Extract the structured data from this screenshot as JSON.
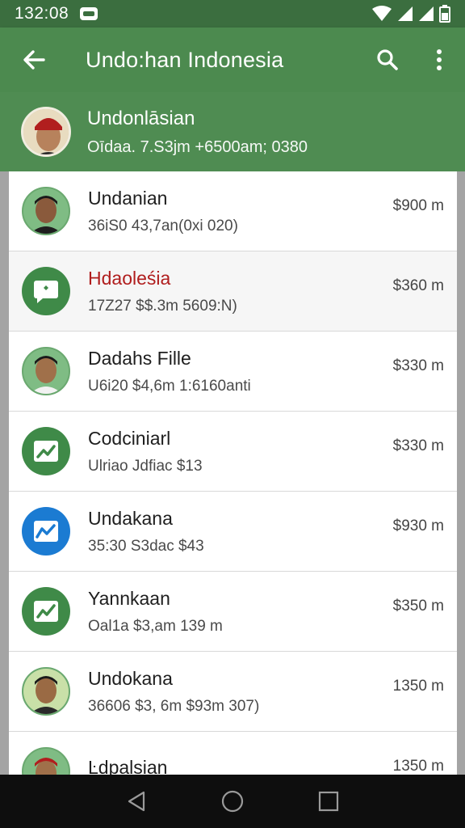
{
  "status_bar": {
    "time": "132:08",
    "icons": [
      "notification-icon",
      "wifi-icon",
      "signal-icon",
      "signal-icon",
      "battery-icon"
    ]
  },
  "app_bar": {
    "title": "Undo:han Indonesia",
    "back_icon": "arrow-back-icon",
    "search_icon": "search-icon",
    "menu_icon": "more-vert-icon"
  },
  "profile": {
    "name": "Undonlāsian",
    "meta": "Oīdaa. 7.S3jm +6500am; 0380"
  },
  "list": {
    "items": [
      {
        "title": "Undanian",
        "subtitle": "36iS0 43,7an(0xi 020)",
        "amount": "$900 m",
        "icon": "person-avatar"
      },
      {
        "title": "Hdaoleśia",
        "subtitle": "17Z27 $$.3m 5609:N)",
        "amount": "$360 m",
        "icon": "chat-bubble-icon"
      },
      {
        "title": "Dadahs Fille",
        "subtitle": "U6i20 $4,6m 1:6160anti",
        "amount": "$330 m",
        "icon": "person-avatar"
      },
      {
        "title": "Codciniarl",
        "subtitle": "Ulriao Jdfiac $13",
        "amount": "$330 m",
        "icon": "chart-icon"
      },
      {
        "title": "Undakana",
        "subtitle": "35:30 S3dac $43",
        "amount": "$930 m",
        "icon": "chart-icon"
      },
      {
        "title": "Yannkaan",
        "subtitle": "Oal1a $3,am 139 m",
        "amount": "$350 m",
        "icon": "chart-icon"
      },
      {
        "title": "Undokana",
        "subtitle": "36606 $3, 6m $93m 307)",
        "amount": "1350 m",
        "icon": "person-avatar"
      },
      {
        "title": "Ŀdpalsian",
        "subtitle": "",
        "amount": "1350 m",
        "icon": "person-avatar"
      }
    ]
  },
  "nav_bar": {
    "back_icon": "nav-back-icon",
    "home_icon": "nav-home-icon",
    "recents_icon": "nav-recents-icon"
  },
  "colors": {
    "status_bar": "#3b6e3f",
    "app_bar": "#4c8a4f",
    "profile_band": "#4f8c52",
    "icon_green": "#3f8a48",
    "icon_blue": "#1b7bd2",
    "highlight_title": "#b01d1d"
  }
}
